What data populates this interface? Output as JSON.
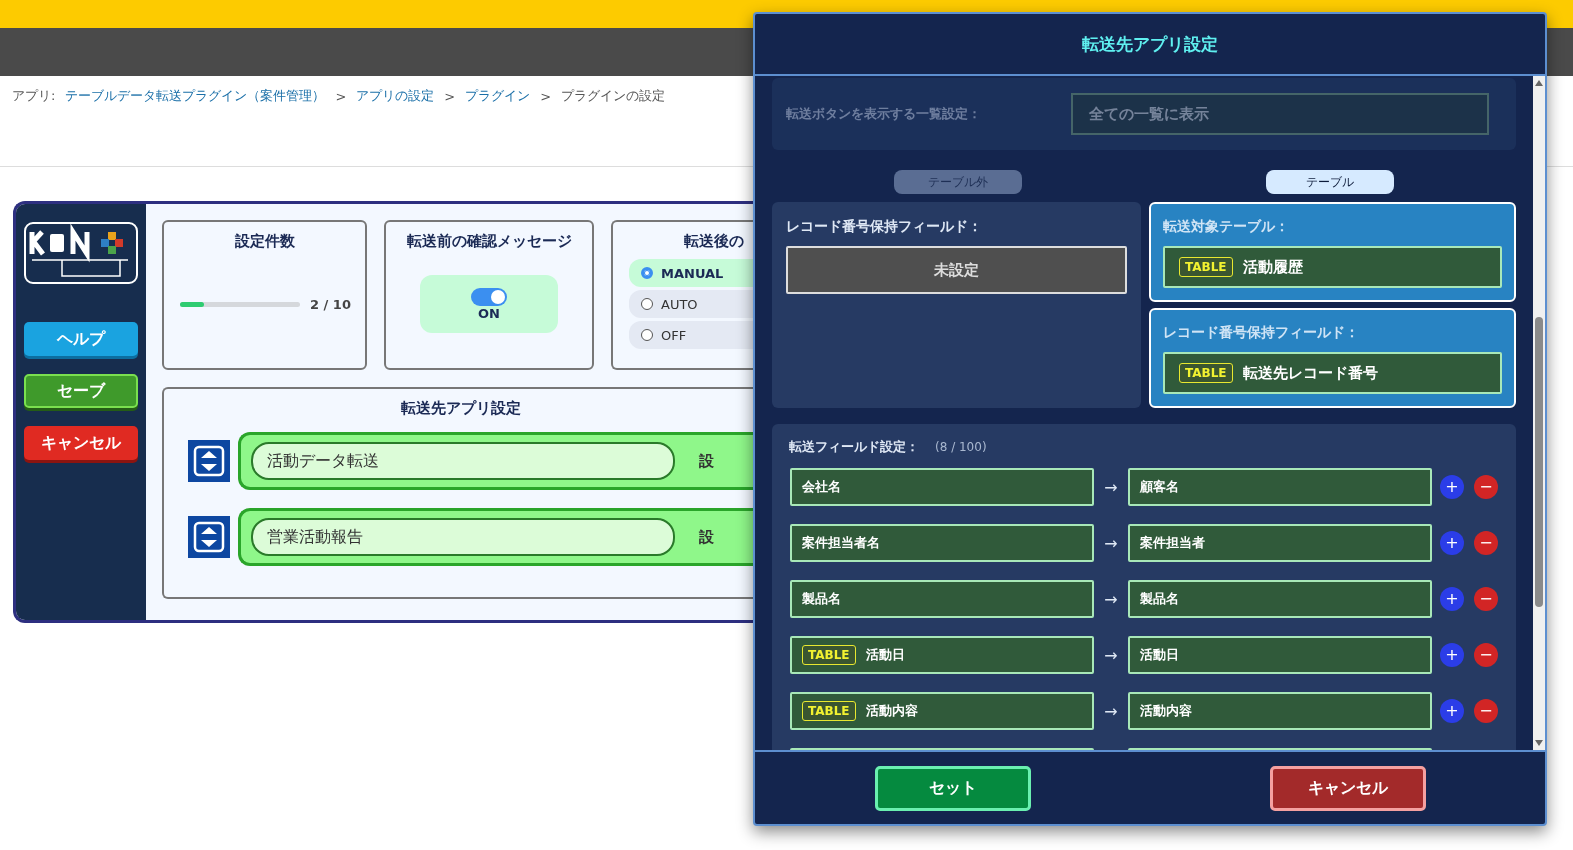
{
  "breadcrumb": [
    {
      "text": "アプリ:",
      "link": false
    },
    {
      "text": "テーブルデータ転送プラグイン（案件管理）",
      "link": true
    },
    {
      "text": ">",
      "link": false
    },
    {
      "text": "アプリの設定",
      "link": true
    },
    {
      "text": ">",
      "link": false
    },
    {
      "text": "プラグイン",
      "link": true
    },
    {
      "text": ">",
      "link": false
    },
    {
      "text": "プラグインの設定",
      "link": false
    }
  ],
  "sidebar": {
    "buttons": [
      {
        "label": "ヘルプ",
        "kind": "help"
      },
      {
        "label": "セーブ",
        "kind": "save"
      },
      {
        "label": "キャンセル",
        "kind": "cancel"
      }
    ]
  },
  "count_card": {
    "title": "設定件数",
    "level": 0.2,
    "reading": "2 / 10"
  },
  "confirm_card": {
    "title": "転送前の確認メッセージ",
    "on": true,
    "label": "ON"
  },
  "after_card": {
    "title": "転送後の",
    "options": [
      {
        "label": "MANUAL",
        "selected": true
      },
      {
        "label": "AUTO",
        "selected": false
      },
      {
        "label": "OFF",
        "selected": false
      }
    ]
  },
  "apps_card": {
    "title": "転送先アプリ設定",
    "items": [
      {
        "name": "活動データ転送",
        "button": "設"
      },
      {
        "name": "営業活動報告",
        "button": "設"
      }
    ]
  },
  "dialog": {
    "title": "転送先アプリ設定",
    "list_setting": {
      "label": "転送ボタンを表示する一覧設定：",
      "value": "全ての一覧に表示",
      "disabled": true
    },
    "tabs": [
      {
        "label": "テーブル外",
        "selected": false
      },
      {
        "label": "テーブル",
        "selected": true
      }
    ],
    "outer_panel": {
      "label": "レコード番号保持フィールド：",
      "value": "未設定"
    },
    "table_panels": [
      {
        "label": "転送対象テーブル：",
        "tag": "TABLE",
        "value": "活動履歴"
      },
      {
        "label": "レコード番号保持フィールド：",
        "tag": "TABLE",
        "value": "転送先レコード番号"
      }
    ],
    "fields": {
      "label": "転送フィールド設定：",
      "count": "(8 / 100)",
      "arrow": "→",
      "add": "+",
      "remove": "−",
      "rows": [
        {
          "source": "会社名",
          "target": "顧客名"
        },
        {
          "source": "案件担当者名",
          "target": "案件担当者"
        },
        {
          "source": "製品名",
          "target": "製品名"
        },
        {
          "tag": "TABLE",
          "source": "活動日",
          "target": "活動日"
        },
        {
          "tag": "TABLE",
          "source": "活動内容",
          "target": "活動内容"
        }
      ]
    },
    "buttons": [
      {
        "label": "セット",
        "kind": "ok"
      },
      {
        "label": "キャンセル",
        "kind": "cancel"
      }
    ]
  }
}
